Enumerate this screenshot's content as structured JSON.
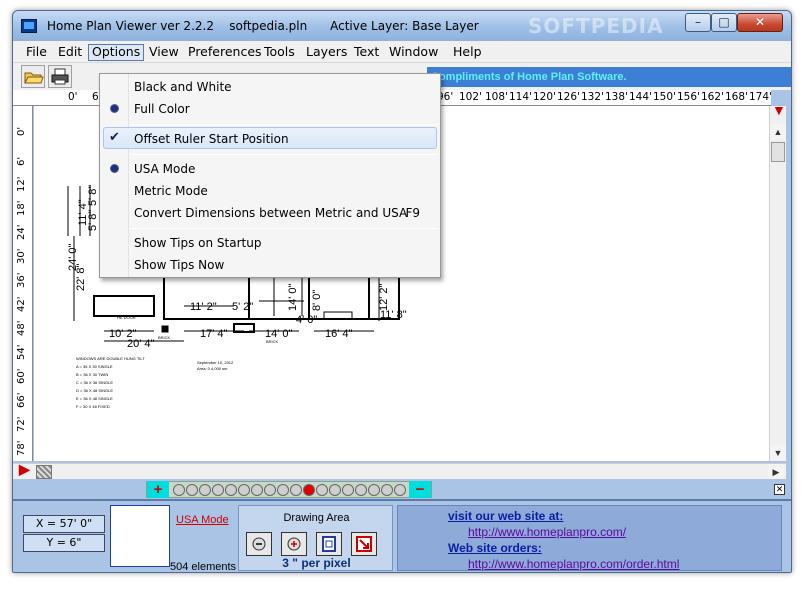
{
  "window": {
    "title": "Home Plan Viewer ver 2.2.2    softpedia.pln      Active Layer: Base Layer",
    "watermark": "SOFTPEDIA",
    "minimize_glyph": "–",
    "maximize_glyph": "□",
    "close_glyph": "✕"
  },
  "menubar": {
    "items": [
      "File",
      "Edit",
      "Options",
      "View",
      "Preferences",
      "Tools",
      "Layers",
      "Text",
      "Window",
      "Help"
    ],
    "active": "Options"
  },
  "toolbar": {
    "buttons": [
      "open-folder-icon",
      "printer-icon"
    ],
    "banner": "Compliments of Home Plan Software."
  },
  "ruler_top": {
    "labels": [
      "0'",
      "6'",
      "96'",
      "102'",
      "108'",
      "114'",
      "120'",
      "126'",
      "132'",
      "138'",
      "144'",
      "150'",
      "156'",
      "162'",
      "168'",
      "174'",
      "18"
    ]
  },
  "ruler_left": {
    "labels": [
      "0'",
      "6'",
      "12'",
      "18'",
      "24'",
      "30'",
      "36'",
      "42'",
      "48'",
      "54'",
      "60'",
      "66'",
      "72'",
      "78'"
    ]
  },
  "plan": {
    "dims": [
      "11' 4\"",
      "5' 8\"",
      "5' 8\"",
      "24' 0\"",
      "22' 8\"",
      "10' 2\"",
      "20' 4\"",
      "17' 4\"",
      "14' 0\"",
      "16' 4\"",
      "11' 2\"",
      "5' 2\"",
      "14' 0\"",
      "8' 0\"",
      "4' 0\"",
      "11' 8\"",
      "12' 2\""
    ],
    "small_notes": [
      "WINDOWS ARE DOUBLE HUNG TILT",
      "A = 36 X 30 SINGLE",
      "B = 36 X 30 TWIN",
      "C = 36 X 36 SINGLE",
      "D = 36 X 48 SINGLE",
      "E = 36 X 48 SINGLE",
      "F = 30 X 48 FIXED",
      "September 10, 2012",
      "Area: 0 4,000 sm",
      "HE DOOR",
      "BRICK",
      "BRICK"
    ]
  },
  "options_menu": {
    "items": [
      {
        "label": "Black and White",
        "mark": "",
        "shortcut": ""
      },
      {
        "label": "Full Color",
        "mark": "radio",
        "shortcut": ""
      },
      {
        "label": "Offset Ruler Start Position",
        "mark": "check",
        "shortcut": ""
      },
      {
        "label": "USA Mode",
        "mark": "radio",
        "shortcut": ""
      },
      {
        "label": "Metric Mode",
        "mark": "",
        "shortcut": ""
      },
      {
        "label": "Convert Dimensions between Metric and USA",
        "mark": "",
        "shortcut": "F9"
      },
      {
        "label": "Show Tips on Startup",
        "mark": "",
        "shortcut": ""
      },
      {
        "label": "Show Tips Now",
        "mark": "",
        "shortcut": ""
      }
    ],
    "check_glyph": "✔"
  },
  "zoom": {
    "plus": "+",
    "minus": "−",
    "levels": 18,
    "active_level_index": 10
  },
  "status": {
    "x_coord": "X = 57' 0\"",
    "y_coord": "Y = 6\"",
    "mode_link": "USA Mode",
    "elements": "504 elements",
    "drawing_area_title": "Drawing Area",
    "per_pixel": "3 \" per pixel",
    "da_buttons": [
      "zoom-out-icon",
      "zoom-in-icon",
      "fit-page-icon",
      "select-area-icon"
    ],
    "visit_heading": "visit our web site at:",
    "visit_url": "http://www.homeplanpro.com/",
    "orders_heading": "Web site orders:",
    "orders_url": "http://www.homeplanpro.com/order.html"
  },
  "colors": {
    "window_bg": "#aac4e6",
    "banner_bg": "#3e7fd6",
    "banner_text": "#5ff0ff",
    "zoom_active": "#e00000",
    "link_color": "#0a1e9e"
  }
}
